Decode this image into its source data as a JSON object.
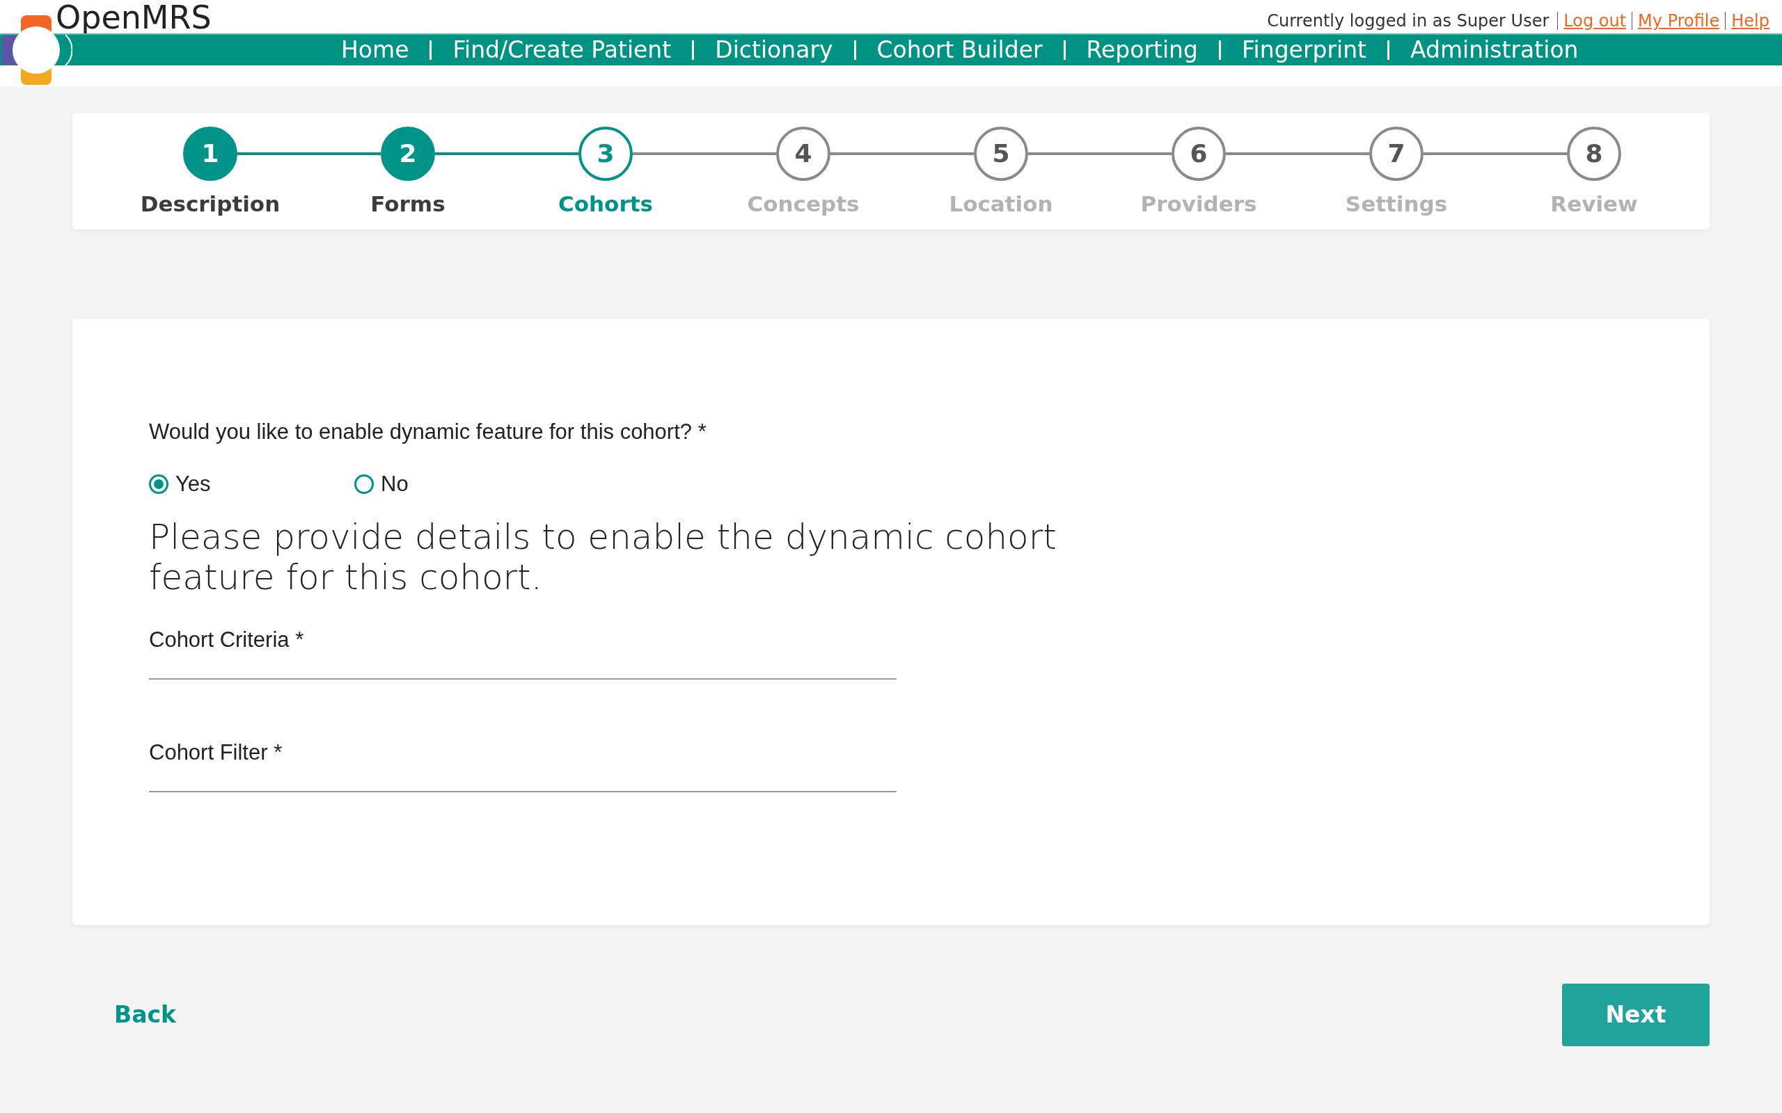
{
  "header": {
    "logo_text": "OpenMRS",
    "user_text": "Currently logged in as Super User",
    "user_links": [
      "Log out",
      "My Profile",
      "Help"
    ],
    "nav": [
      "Home",
      "Find/Create Patient",
      "Dictionary",
      "Cohort Builder",
      "Reporting",
      "Fingerprint",
      "Administration"
    ]
  },
  "steps": [
    {
      "number": "1",
      "label": "Description",
      "kind": "done"
    },
    {
      "number": "2",
      "label": "Forms",
      "kind": "done"
    },
    {
      "number": "3",
      "label": "Cohorts",
      "kind": "current"
    },
    {
      "number": "4",
      "label": "Concepts",
      "kind": "upcoming"
    },
    {
      "number": "5",
      "label": "Location",
      "kind": "upcoming"
    },
    {
      "number": "6",
      "label": "Providers",
      "kind": "upcoming"
    },
    {
      "number": "7",
      "label": "Settings",
      "kind": "upcoming"
    },
    {
      "number": "8",
      "label": "Review",
      "kind": "upcoming"
    }
  ],
  "form": {
    "question": "Would you like to enable dynamic feature for this cohort? *",
    "options": [
      {
        "label": "Yes",
        "selected": true
      },
      {
        "label": "No",
        "selected": false
      }
    ],
    "heading": "Please provide details to enable the dynamic cohort feature for this cohort.",
    "fields": [
      {
        "label": "Cohort Criteria *"
      },
      {
        "label": "Cohort Filter *"
      }
    ]
  },
  "footer": {
    "back": "Back",
    "next": "Next"
  }
}
